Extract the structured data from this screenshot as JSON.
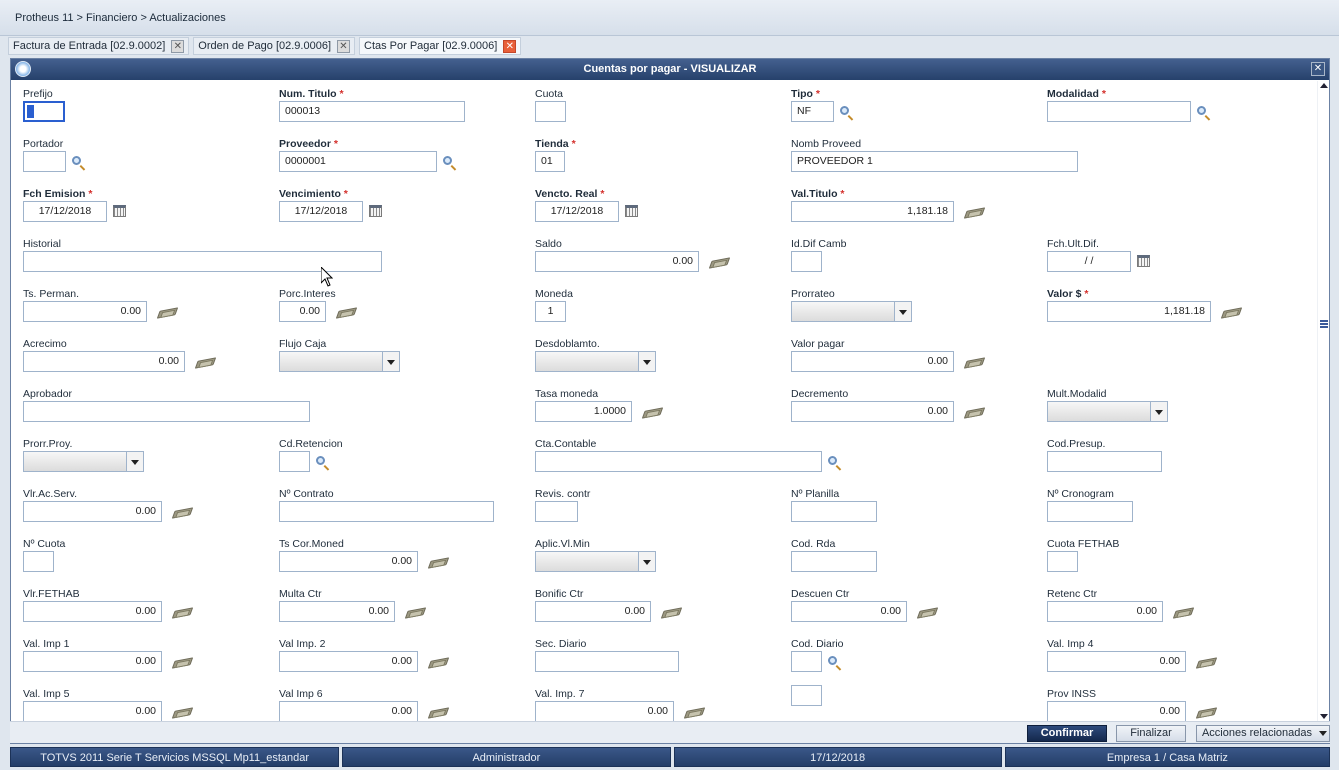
{
  "breadcrumb": "Protheus 11 > Financiero > Actualizaciones",
  "tabs": [
    {
      "label": "Factura de Entrada [02.9.0002]",
      "active": false
    },
    {
      "label": "Orden de Pago [02.9.0006]",
      "active": false
    },
    {
      "label": "Ctas Por Pagar [02.9.0006]",
      "active": true
    }
  ],
  "dialog": {
    "title": "Cuentas por pagar - VISUALIZAR"
  },
  "fields": {
    "prefijo": {
      "label": "Prefijo",
      "value": ""
    },
    "num_titulo": {
      "label": "Num. Titulo",
      "value": "000013"
    },
    "cuota": {
      "label": "Cuota",
      "value": ""
    },
    "tipo": {
      "label": "Tipo",
      "value": "NF"
    },
    "modalidad": {
      "label": "Modalidad",
      "value": ""
    },
    "portador": {
      "label": "Portador",
      "value": ""
    },
    "proveedor": {
      "label": "Proveedor",
      "value": "0000001"
    },
    "tienda": {
      "label": "Tienda",
      "value": "01"
    },
    "nomb_proveed": {
      "label": "Nomb Proveed",
      "value": "PROVEEDOR 1"
    },
    "fch_emision": {
      "label": "Fch Emision",
      "value": "17/12/2018"
    },
    "vencimiento": {
      "label": "Vencimiento",
      "value": "17/12/2018"
    },
    "vencto_real": {
      "label": "Vencto. Real",
      "value": "17/12/2018"
    },
    "val_titulo": {
      "label": "Val.Titulo",
      "value": "1,181.18"
    },
    "historial": {
      "label": "Historial",
      "value": ""
    },
    "saldo": {
      "label": "Saldo",
      "value": "0.00"
    },
    "id_dif_camb": {
      "label": "Id.Dif Camb",
      "value": ""
    },
    "fch_ult_dif": {
      "label": "Fch.Ult.Dif.",
      "value": "/  /"
    },
    "ts_perman": {
      "label": "Ts. Perman.",
      "value": "0.00"
    },
    "porc_interes": {
      "label": "Porc.Interes",
      "value": "0.00"
    },
    "moneda": {
      "label": "Moneda",
      "value": "1"
    },
    "prorrateo": {
      "label": "Prorrateo",
      "value": ""
    },
    "valor_s": {
      "label": "Valor $",
      "value": "1,181.18"
    },
    "acrecimo": {
      "label": "Acrecimo",
      "value": "0.00"
    },
    "flujo_caja": {
      "label": "Flujo Caja",
      "value": ""
    },
    "desdoblamto": {
      "label": "Desdoblamto.",
      "value": ""
    },
    "valor_pagar": {
      "label": "Valor pagar",
      "value": "0.00"
    },
    "aprobador": {
      "label": "Aprobador",
      "value": ""
    },
    "tasa_moneda": {
      "label": "Tasa moneda",
      "value": "1.0000"
    },
    "decremento": {
      "label": "Decremento",
      "value": "0.00"
    },
    "mult_modalid": {
      "label": "Mult.Modalid",
      "value": ""
    },
    "prorr_proy": {
      "label": "Prorr.Proy.",
      "value": ""
    },
    "cd_retencion": {
      "label": "Cd.Retencion",
      "value": ""
    },
    "cta_contable": {
      "label": "Cta.Contable",
      "value": ""
    },
    "cod_presup": {
      "label": "Cod.Presup.",
      "value": ""
    },
    "vlr_ac_serv": {
      "label": "Vlr.Ac.Serv.",
      "value": "0.00"
    },
    "n_contrato": {
      "label": "Nº Contrato",
      "value": ""
    },
    "revis_contr": {
      "label": "Revis. contr",
      "value": ""
    },
    "n_planilla": {
      "label": "Nº Planilla",
      "value": ""
    },
    "n_cronogram": {
      "label": "Nº Cronogram",
      "value": ""
    },
    "n_cuota": {
      "label": "Nº Cuota",
      "value": ""
    },
    "ts_cor_moned": {
      "label": "Ts Cor.Moned",
      "value": "0.00"
    },
    "aplic_vl_min": {
      "label": "Aplic.Vl.Min",
      "value": ""
    },
    "cod_rda": {
      "label": "Cod. Rda",
      "value": ""
    },
    "cuota_fethab": {
      "label": "Cuota FETHAB",
      "value": ""
    },
    "vlr_fethab": {
      "label": "Vlr.FETHAB",
      "value": "0.00"
    },
    "multa_ctr": {
      "label": "Multa Ctr",
      "value": "0.00"
    },
    "bonific_ctr": {
      "label": "Bonific Ctr",
      "value": "0.00"
    },
    "descuen_ctr": {
      "label": "Descuen Ctr",
      "value": "0.00"
    },
    "retenc_ctr": {
      "label": "Retenc Ctr",
      "value": "0.00"
    },
    "val_imp_1": {
      "label": "Val. Imp 1",
      "value": "0.00"
    },
    "val_imp_2": {
      "label": "Val Imp. 2",
      "value": "0.00"
    },
    "sec_diario": {
      "label": "Sec. Diario",
      "value": ""
    },
    "cod_diario": {
      "label": "Cod. Diario",
      "value": ""
    },
    "val_imp_4": {
      "label": "Val. Imp 4",
      "value": "0.00"
    },
    "val_imp_5": {
      "label": "Val. Imp 5",
      "value": "0.00"
    },
    "val_imp_6": {
      "label": "Val Imp 6",
      "value": "0.00"
    },
    "val_imp_7": {
      "label": "Val. Imp. 7",
      "value": "0.00"
    },
    "unlabeled": {
      "label": "",
      "value": ""
    },
    "prov_inss": {
      "label": "Prov INSS",
      "value": "0.00"
    }
  },
  "buttons": {
    "confirmar": "Confirmar",
    "finalizar": "Finalizar",
    "acciones": "Acciones relacionadas"
  },
  "statusbar": {
    "environment": "TOTVS 2011 Serie T Servicios MSSQL Mp11_estandar",
    "user": "Administrador",
    "date": "17/12/2018",
    "company": "Empresa 1 / Casa Matriz"
  }
}
